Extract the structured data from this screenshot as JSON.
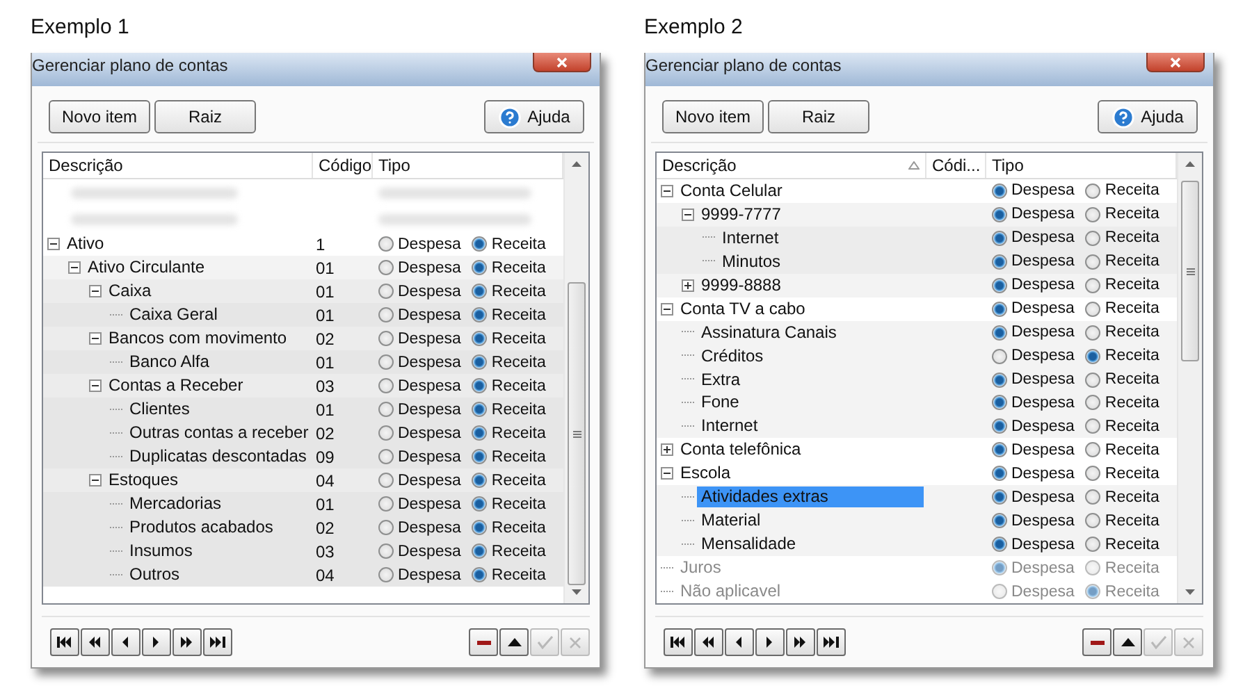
{
  "examples": [
    {
      "caption": "Exemplo 1",
      "window": {
        "title": "Gerenciar plano de contas"
      },
      "toolbar": [
        {
          "label": "Novo item",
          "kind": "plain"
        },
        {
          "label": "Raiz",
          "kind": "plain"
        },
        {
          "label": "Ajuda",
          "kind": "help"
        }
      ],
      "columns": [
        {
          "label": "Descrição",
          "sorted": false
        },
        {
          "label": "Código",
          "sorted": false
        },
        {
          "label": "Tipo",
          "sorted": false
        }
      ],
      "tree": [
        {
          "kind": "blurred"
        },
        {
          "kind": "blurred"
        },
        {
          "kind": "row",
          "label": "Ativo",
          "code": "1",
          "expanded": true,
          "selected": false,
          "types": [
            {
              "label": "Despesa",
              "selected": false
            },
            {
              "label": "Receita",
              "selected": true
            }
          ],
          "children": [
            {
              "kind": "row",
              "label": "Ativo Circulante",
              "code": "01",
              "expanded": true,
              "selected": false,
              "types": [
                {
                  "label": "Despesa",
                  "selected": false
                },
                {
                  "label": "Receita",
                  "selected": true
                }
              ],
              "children": [
                {
                  "kind": "row",
                  "label": "Caixa",
                  "code": "01",
                  "expanded": true,
                  "selected": false,
                  "types": [
                    {
                      "label": "Despesa",
                      "selected": false
                    },
                    {
                      "label": "Receita",
                      "selected": true
                    }
                  ],
                  "children": [
                    {
                      "kind": "row",
                      "label": "Caixa Geral",
                      "code": "01",
                      "selected": false,
                      "types": [
                        {
                          "label": "Despesa",
                          "selected": false
                        },
                        {
                          "label": "Receita",
                          "selected": true
                        }
                      ]
                    }
                  ]
                },
                {
                  "kind": "row",
                  "label": "Bancos com movimento",
                  "code": "02",
                  "expanded": true,
                  "selected": false,
                  "types": [
                    {
                      "label": "Despesa",
                      "selected": false
                    },
                    {
                      "label": "Receita",
                      "selected": true
                    }
                  ],
                  "children": [
                    {
                      "kind": "row",
                      "label": "Banco Alfa",
                      "code": "01",
                      "selected": false,
                      "types": [
                        {
                          "label": "Despesa",
                          "selected": false
                        },
                        {
                          "label": "Receita",
                          "selected": true
                        }
                      ]
                    }
                  ]
                },
                {
                  "kind": "row",
                  "label": "Contas a Receber",
                  "code": "03",
                  "expanded": true,
                  "selected": false,
                  "types": [
                    {
                      "label": "Despesa",
                      "selected": false
                    },
                    {
                      "label": "Receita",
                      "selected": true
                    }
                  ],
                  "children": [
                    {
                      "kind": "row",
                      "label": "Clientes",
                      "code": "01",
                      "selected": false,
                      "types": [
                        {
                          "label": "Despesa",
                          "selected": false
                        },
                        {
                          "label": "Receita",
                          "selected": true
                        }
                      ]
                    },
                    {
                      "kind": "row",
                      "label": "Outras contas a receber",
                      "code": "02",
                      "selected": false,
                      "types": [
                        {
                          "label": "Despesa",
                          "selected": false
                        },
                        {
                          "label": "Receita",
                          "selected": true
                        }
                      ]
                    },
                    {
                      "kind": "row",
                      "label": "Duplicatas descontadas",
                      "code": "09",
                      "selected": false,
                      "types": [
                        {
                          "label": "Despesa",
                          "selected": false
                        },
                        {
                          "label": "Receita",
                          "selected": true
                        }
                      ]
                    }
                  ]
                },
                {
                  "kind": "row",
                  "label": "Estoques",
                  "code": "04",
                  "expanded": true,
                  "selected": false,
                  "types": [
                    {
                      "label": "Despesa",
                      "selected": false
                    },
                    {
                      "label": "Receita",
                      "selected": true
                    }
                  ],
                  "children": [
                    {
                      "kind": "row",
                      "label": "Mercadorias",
                      "code": "01",
                      "selected": false,
                      "types": [
                        {
                          "label": "Despesa",
                          "selected": false
                        },
                        {
                          "label": "Receita",
                          "selected": true
                        }
                      ]
                    },
                    {
                      "kind": "row",
                      "label": "Produtos acabados",
                      "code": "02",
                      "selected": false,
                      "types": [
                        {
                          "label": "Despesa",
                          "selected": false
                        },
                        {
                          "label": "Receita",
                          "selected": true
                        }
                      ]
                    },
                    {
                      "kind": "row",
                      "label": "Insumos",
                      "code": "03",
                      "selected": false,
                      "types": [
                        {
                          "label": "Despesa",
                          "selected": false
                        },
                        {
                          "label": "Receita",
                          "selected": true
                        }
                      ]
                    },
                    {
                      "kind": "row",
                      "label": "Outros",
                      "code": "04",
                      "selected": false,
                      "types": [
                        {
                          "label": "Despesa",
                          "selected": false
                        },
                        {
                          "label": "Receita",
                          "selected": true
                        }
                      ]
                    }
                  ]
                }
              ]
            }
          ]
        }
      ],
      "nav": [
        {
          "kind": "first",
          "disabled": false
        },
        {
          "kind": "prev-page",
          "disabled": false
        },
        {
          "kind": "prev",
          "disabled": false
        },
        {
          "kind": "next",
          "disabled": false
        },
        {
          "kind": "next-page",
          "disabled": false
        },
        {
          "kind": "last",
          "disabled": false
        }
      ],
      "actions": [
        {
          "kind": "delete",
          "disabled": false
        },
        {
          "kind": "up",
          "disabled": false
        },
        {
          "kind": "confirm",
          "disabled": true
        },
        {
          "kind": "cancel",
          "disabled": true
        }
      ]
    },
    {
      "caption": "Exemplo 2",
      "window": {
        "title": "Gerenciar plano de contas"
      },
      "toolbar": [
        {
          "label": "Novo item",
          "kind": "plain"
        },
        {
          "label": "Raiz",
          "kind": "plain"
        },
        {
          "label": "Ajuda",
          "kind": "help"
        }
      ],
      "columns": [
        {
          "label": "Descrição",
          "sorted": true
        },
        {
          "label": "Códi...",
          "sorted": false
        },
        {
          "label": "Tipo",
          "sorted": false
        }
      ],
      "tree": [
        {
          "kind": "row",
          "label": "Conta Celular",
          "expanded": true,
          "selected": false,
          "disabled": false,
          "types": [
            {
              "label": "Despesa",
              "selected": true
            },
            {
              "label": "Receita",
              "selected": false
            }
          ],
          "children": [
            {
              "kind": "row",
              "label": "9999-7777",
              "expanded": true,
              "selected": false,
              "disabled": false,
              "types": [
                {
                  "label": "Despesa",
                  "selected": true
                },
                {
                  "label": "Receita",
                  "selected": false
                }
              ],
              "children": [
                {
                  "kind": "row",
                  "label": "Internet",
                  "selected": false,
                  "disabled": false,
                  "types": [
                    {
                      "label": "Despesa",
                      "selected": true
                    },
                    {
                      "label": "Receita",
                      "selected": false
                    }
                  ]
                },
                {
                  "kind": "row",
                  "label": "Minutos",
                  "selected": false,
                  "disabled": false,
                  "types": [
                    {
                      "label": "Despesa",
                      "selected": true
                    },
                    {
                      "label": "Receita",
                      "selected": false
                    }
                  ]
                }
              ]
            },
            {
              "kind": "row",
              "label": "9999-8888",
              "expanded": false,
              "selected": false,
              "disabled": false,
              "types": [
                {
                  "label": "Despesa",
                  "selected": true
                },
                {
                  "label": "Receita",
                  "selected": false
                }
              ]
            }
          ]
        },
        {
          "kind": "row",
          "label": "Conta TV a cabo",
          "expanded": true,
          "selected": false,
          "disabled": false,
          "types": [
            {
              "label": "Despesa",
              "selected": true
            },
            {
              "label": "Receita",
              "selected": false
            }
          ],
          "children": [
            {
              "kind": "row",
              "label": "Assinatura Canais",
              "selected": false,
              "disabled": false,
              "types": [
                {
                  "label": "Despesa",
                  "selected": true
                },
                {
                  "label": "Receita",
                  "selected": false
                }
              ]
            },
            {
              "kind": "row",
              "label": "Créditos",
              "selected": false,
              "disabled": false,
              "types": [
                {
                  "label": "Despesa",
                  "selected": false
                },
                {
                  "label": "Receita",
                  "selected": true
                }
              ]
            },
            {
              "kind": "row",
              "label": "Extra",
              "selected": false,
              "disabled": false,
              "types": [
                {
                  "label": "Despesa",
                  "selected": true
                },
                {
                  "label": "Receita",
                  "selected": false
                }
              ]
            },
            {
              "kind": "row",
              "label": "Fone",
              "selected": false,
              "disabled": false,
              "types": [
                {
                  "label": "Despesa",
                  "selected": true
                },
                {
                  "label": "Receita",
                  "selected": false
                }
              ]
            },
            {
              "kind": "row",
              "label": "Internet",
              "selected": false,
              "disabled": false,
              "types": [
                {
                  "label": "Despesa",
                  "selected": true
                },
                {
                  "label": "Receita",
                  "selected": false
                }
              ]
            }
          ]
        },
        {
          "kind": "row",
          "label": "Conta telefônica",
          "expanded": false,
          "selected": false,
          "disabled": false,
          "types": [
            {
              "label": "Despesa",
              "selected": true
            },
            {
              "label": "Receita",
              "selected": false
            }
          ]
        },
        {
          "kind": "row",
          "label": "Escola",
          "expanded": true,
          "selected": false,
          "disabled": false,
          "types": [
            {
              "label": "Despesa",
              "selected": true
            },
            {
              "label": "Receita",
              "selected": false
            }
          ],
          "children": [
            {
              "kind": "row",
              "label": "Atividades extras",
              "selected": true,
              "disabled": false,
              "types": [
                {
                  "label": "Despesa",
                  "selected": true
                },
                {
                  "label": "Receita",
                  "selected": false
                }
              ]
            },
            {
              "kind": "row",
              "label": "Material",
              "selected": false,
              "disabled": false,
              "types": [
                {
                  "label": "Despesa",
                  "selected": true
                },
                {
                  "label": "Receita",
                  "selected": false
                }
              ]
            },
            {
              "kind": "row",
              "label": "Mensalidade",
              "selected": false,
              "disabled": false,
              "types": [
                {
                  "label": "Despesa",
                  "selected": true
                },
                {
                  "label": "Receita",
                  "selected": false
                }
              ]
            }
          ]
        },
        {
          "kind": "row",
          "label": "Juros",
          "selected": false,
          "disabled": true,
          "types": [
            {
              "label": "Despesa",
              "selected": true
            },
            {
              "label": "Receita",
              "selected": false
            }
          ]
        },
        {
          "kind": "row",
          "label": "Não aplicavel",
          "selected": false,
          "disabled": true,
          "types": [
            {
              "label": "Despesa",
              "selected": false
            },
            {
              "label": "Receita",
              "selected": true
            }
          ]
        }
      ],
      "nav": [
        {
          "kind": "first",
          "disabled": false
        },
        {
          "kind": "prev-page",
          "disabled": false
        },
        {
          "kind": "prev",
          "disabled": false
        },
        {
          "kind": "next",
          "disabled": false
        },
        {
          "kind": "next-page",
          "disabled": false
        },
        {
          "kind": "last",
          "disabled": false
        }
      ],
      "actions": [
        {
          "kind": "delete",
          "disabled": false
        },
        {
          "kind": "up",
          "disabled": false
        },
        {
          "kind": "confirm",
          "disabled": true
        },
        {
          "kind": "cancel",
          "disabled": true
        }
      ]
    }
  ]
}
